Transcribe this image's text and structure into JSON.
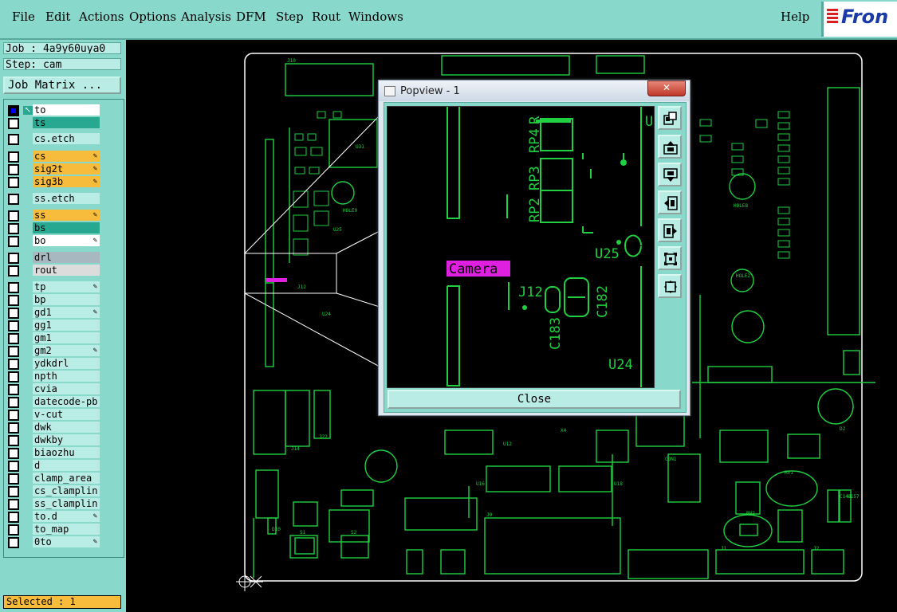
{
  "menu": {
    "file": "File",
    "edit": "Edit",
    "actions": "Actions",
    "options": "Options",
    "analysis": "Analysis",
    "dfm": "DFM",
    "step": "Step",
    "rout": "Rout",
    "windows": "Windows",
    "help": "Help"
  },
  "logo": {
    "text": "Fron"
  },
  "job": {
    "job_line": "Job : 4a9y60uya0",
    "step_line": "Step: cam",
    "matrix_button": "Job Matrix ..."
  },
  "layers": [
    {
      "name": "to",
      "type": "white",
      "checked": true,
      "pen": false
    },
    {
      "name": "ts",
      "type": "teal",
      "checked": false,
      "pen": false
    },
    {
      "name": "cs.etch",
      "type": "default",
      "checked": false,
      "pen": false
    },
    {
      "name": "cs",
      "type": "orange",
      "checked": false,
      "pen": true
    },
    {
      "name": "sig2t",
      "type": "orange",
      "checked": false,
      "pen": true
    },
    {
      "name": "sig3b",
      "type": "orange",
      "checked": false,
      "pen": true
    },
    {
      "name": "ss.etch",
      "type": "default",
      "checked": false,
      "pen": false
    },
    {
      "name": "ss",
      "type": "orange",
      "checked": false,
      "pen": true
    },
    {
      "name": "bs",
      "type": "teal",
      "checked": false,
      "pen": false
    },
    {
      "name": "bo",
      "type": "white",
      "checked": false,
      "pen": true
    },
    {
      "name": "drl",
      "type": "gray",
      "checked": false,
      "pen": false
    },
    {
      "name": "rout",
      "type": "light",
      "checked": false,
      "pen": false
    },
    {
      "name": "tp",
      "type": "default",
      "checked": false,
      "pen": true
    },
    {
      "name": "bp",
      "type": "default",
      "checked": false,
      "pen": false
    },
    {
      "name": "gd1",
      "type": "default",
      "checked": false,
      "pen": true
    },
    {
      "name": "gg1",
      "type": "default",
      "checked": false,
      "pen": false
    },
    {
      "name": "gm1",
      "type": "default",
      "checked": false,
      "pen": false
    },
    {
      "name": "gm2",
      "type": "default",
      "checked": false,
      "pen": true
    },
    {
      "name": "ydkdrl",
      "type": "default",
      "checked": false,
      "pen": false
    },
    {
      "name": "npth",
      "type": "default",
      "checked": false,
      "pen": false
    },
    {
      "name": "cvia",
      "type": "default",
      "checked": false,
      "pen": false
    },
    {
      "name": "datecode-pb",
      "type": "default",
      "checked": false,
      "pen": false
    },
    {
      "name": "v-cut",
      "type": "default",
      "checked": false,
      "pen": false
    },
    {
      "name": "dwk",
      "type": "default",
      "checked": false,
      "pen": false
    },
    {
      "name": "dwkby",
      "type": "default",
      "checked": false,
      "pen": false
    },
    {
      "name": "biaozhu",
      "type": "default",
      "checked": false,
      "pen": false
    },
    {
      "name": "d",
      "type": "default",
      "checked": false,
      "pen": false
    },
    {
      "name": "clamp_area",
      "type": "default",
      "checked": false,
      "pen": false
    },
    {
      "name": "cs_clamplin",
      "type": "default",
      "checked": false,
      "pen": false
    },
    {
      "name": "ss_clamplin",
      "type": "default",
      "checked": false,
      "pen": false
    },
    {
      "name": "to.d",
      "type": "default",
      "checked": false,
      "pen": true
    },
    {
      "name": "to_map",
      "type": "default",
      "checked": false,
      "pen": false
    },
    {
      "name": "0to",
      "type": "default",
      "checked": false,
      "pen": true
    }
  ],
  "status": {
    "selected": "Selected : 1"
  },
  "popview": {
    "title": "Popview - 1",
    "close_button": "Close",
    "labels": {
      "rp4": "RP4",
      "r": "R",
      "rp3": "RP3",
      "rp2": "RP2",
      "u25": "U25",
      "camera": "Camera",
      "j12": "J12",
      "c182": "C182",
      "c183": "C183",
      "u24": "U24",
      "u": "U"
    },
    "tools": [
      "zoom-home-icon",
      "pan-up-icon",
      "pan-down-icon",
      "pan-left-icon",
      "pan-right-icon",
      "zoom-in-icon",
      "zoom-out-icon"
    ]
  },
  "pcb_labels": {
    "j10": "J10",
    "j12": "J12",
    "u24": "U24",
    "u25": "U25",
    "u31": "U31",
    "hole9": "HOLE9",
    "hole8": "HOLE8",
    "hole2": "HOLE2",
    "j14": "J14",
    "j22": "J22",
    "x4": "X4",
    "u12": "U12",
    "u16": "U16",
    "u18": "U18",
    "d10": "D10",
    "j1": "J1",
    "j2": "J2",
    "j9": "J9",
    "s1": "S1",
    "s2": "S2",
    "con1": "CON1",
    "rv1": "RV1",
    "rv2": "RV2",
    "d2": "D2",
    "c144": "C144",
    "c157": "C157"
  },
  "colors": {
    "ui_teal": "#88d8cc",
    "pcb_green": "#20d040",
    "highlight_magenta": "#e020e0",
    "layer_orange": "#f8bc3c"
  }
}
